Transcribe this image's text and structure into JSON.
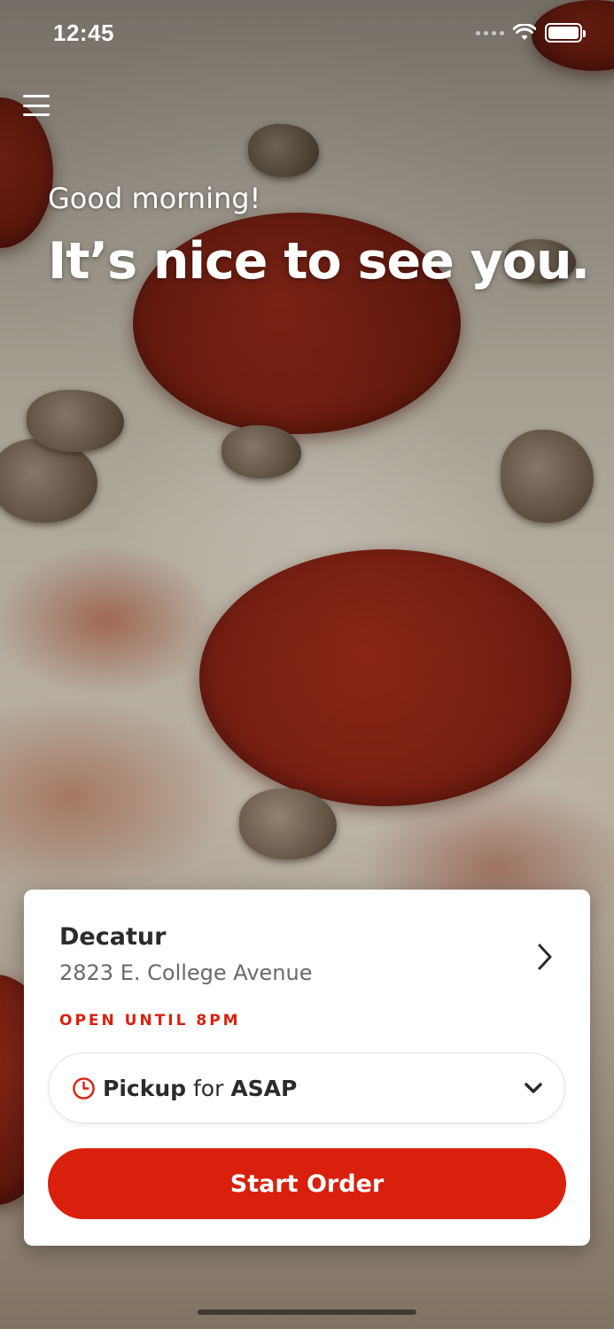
{
  "status_bar": {
    "time": "12:45"
  },
  "header": {
    "greeting": "Good morning!",
    "headline": "It’s nice to see you."
  },
  "store": {
    "name": "Decatur",
    "address": "2823 E. College Avenue",
    "hours_status": "OPEN UNTIL 8PM"
  },
  "order_mode": {
    "mode": "Pickup",
    "connector": "for",
    "time": "ASAP"
  },
  "actions": {
    "start_order_label": "Start Order"
  },
  "theme": {
    "accent": "#d9200c",
    "card_bg": "#ffffff",
    "text_dark": "#2b2b2b",
    "text_muted": "#6a6a6a"
  },
  "icons": {
    "menu": "hamburger-menu-icon",
    "store_chevron": "chevron-right-icon",
    "clock": "clock-icon",
    "dropdown": "chevron-down-icon",
    "wifi": "wifi-icon",
    "battery": "battery-icon"
  }
}
